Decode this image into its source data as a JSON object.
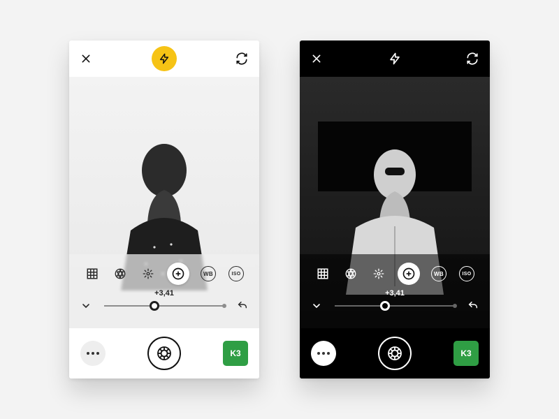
{
  "screens": {
    "left": {
      "theme": "light"
    },
    "right": {
      "theme": "dark"
    }
  },
  "controls": {
    "tool_strip": {
      "wb_label": "WB",
      "iso_label": "ISO",
      "exposure_value": "+3,41",
      "slider_position_percent": 42
    },
    "filter": {
      "active_label": "K3",
      "color": "#2f9e44"
    },
    "flash_accent": "#f6c315"
  }
}
